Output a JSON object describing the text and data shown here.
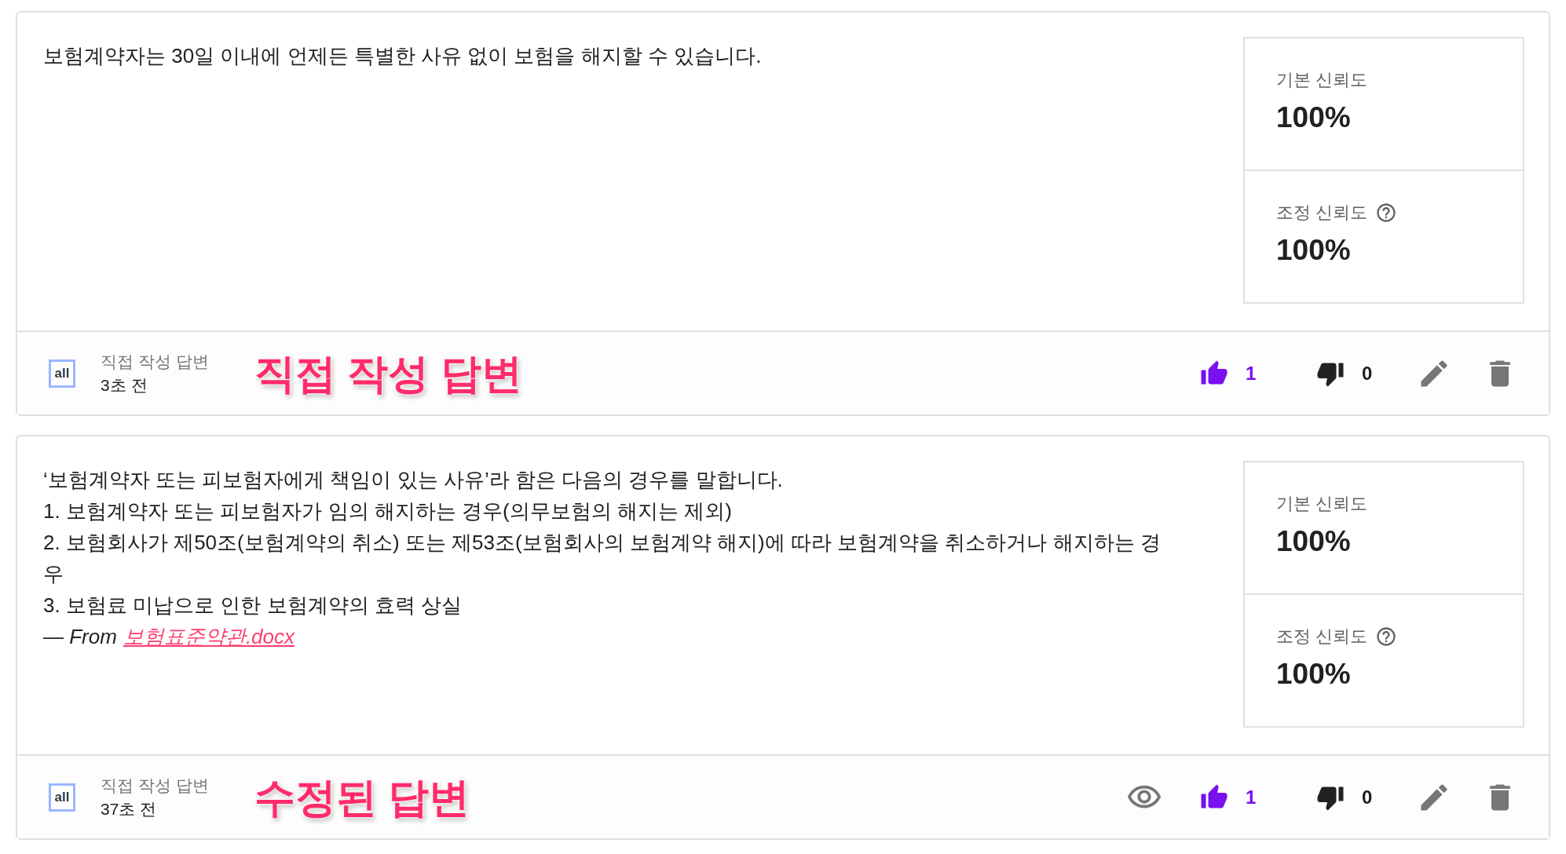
{
  "cards": [
    {
      "lines": [
        "보험계약자는 30일 이내에 언제든 특별한 사유 없이 보험을 해지할 수 있습니다."
      ],
      "metrics": [
        {
          "kind": "plain",
          "label": "기본 신뢰도",
          "value": "100%"
        },
        {
          "kind": "help",
          "label": "조정 신뢰도",
          "value": "100%"
        }
      ],
      "logo": "all",
      "author": "직접 작성 답변",
      "time": "3초 전",
      "annotation": "직접 작성 답변",
      "has_preview": false,
      "likes": "1",
      "liked": true,
      "dislikes": "0",
      "disliked": false
    },
    {
      "lines": [
        "‘보험계약자 또는 피보험자에게 책임이 있는 사유’라 함은 다음의 경우를 말합니다.",
        "1. 보험계약자 또는 피보험자가 임의 해지하는 경우(의무보험의 해지는 제외)",
        "2. 보험회사가 제50조(보험계약의 취소) 또는 제53조(보험회사의 보험계약 해지)에 따라 보험계약을 취소하거나 해지하는 경",
        "우",
        "3. 보험료 미납으로 인한 보험계약의 효력 상실"
      ],
      "source": {
        "prefix": "— From",
        "link": "보험표준약관.docx"
      },
      "metrics": [
        {
          "kind": "plain",
          "label": "기본 신뢰도",
          "value": "100%"
        },
        {
          "kind": "help",
          "label": "조정 신뢰도",
          "value": "100%"
        }
      ],
      "logo": "all",
      "author": "직접 작성 답변",
      "time": "37초 전",
      "annotation": "수정된 답변",
      "has_preview": true,
      "likes": "1",
      "liked": true,
      "dislikes": "0",
      "disliked": false
    }
  ]
}
